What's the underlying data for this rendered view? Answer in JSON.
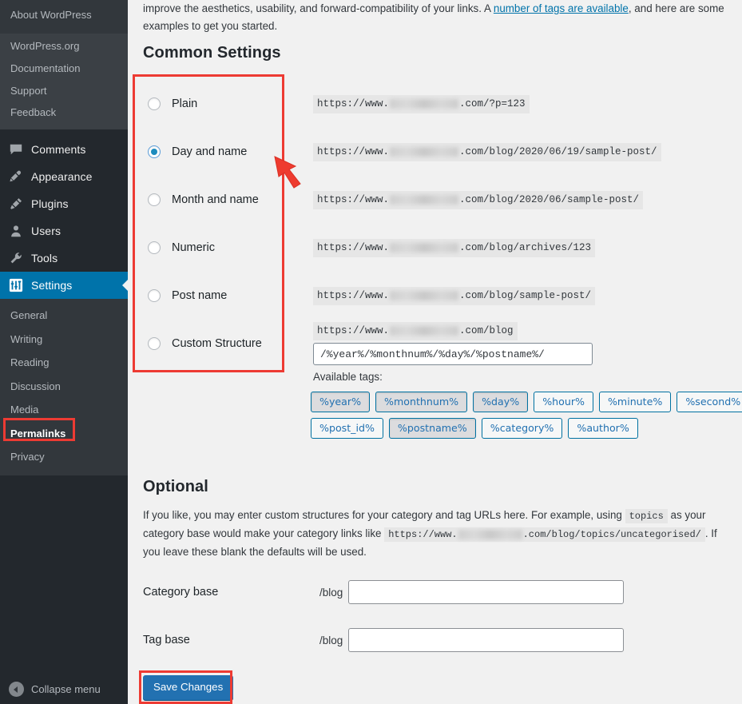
{
  "sidebar": {
    "flyout": {
      "title": "About WordPress",
      "items": [
        "WordPress.org",
        "Documentation",
        "Support",
        "Feedback"
      ]
    },
    "menu": [
      {
        "label": "Comments",
        "icon": "comment-icon",
        "current": false
      },
      {
        "label": "Appearance",
        "icon": "appearance-brush-icon",
        "current": false
      },
      {
        "label": "Plugins",
        "icon": "plugin-plug-icon",
        "current": false
      },
      {
        "label": "Users",
        "icon": "user-icon",
        "current": false
      },
      {
        "label": "Tools",
        "icon": "wrench-icon",
        "current": false
      },
      {
        "label": "Settings",
        "icon": "settings-sliders-icon",
        "current": true
      }
    ],
    "submenu": [
      {
        "label": "General",
        "active": false
      },
      {
        "label": "Writing",
        "active": false
      },
      {
        "label": "Reading",
        "active": false
      },
      {
        "label": "Discussion",
        "active": false
      },
      {
        "label": "Media",
        "active": false
      },
      {
        "label": "Permalinks",
        "active": true
      },
      {
        "label": "Privacy",
        "active": false
      }
    ],
    "collapse_label": "Collapse menu"
  },
  "intro": {
    "text_before_link": "improve the aesthetics, usability, and forward-compatibility of your links. A ",
    "link_text": "number of tags are available",
    "text_after_link": ", and here are some examples to get you started."
  },
  "common_settings": {
    "heading": "Common Settings",
    "options": [
      {
        "label": "Plain",
        "checked": false,
        "example_prefix": "https://www.",
        "example_suffix": ".com/?p=123"
      },
      {
        "label": "Day and name",
        "checked": true,
        "example_prefix": "https://www.",
        "example_suffix": ".com/blog/2020/06/19/sample-post/"
      },
      {
        "label": "Month and name",
        "checked": false,
        "example_prefix": "https://www.",
        "example_suffix": ".com/blog/2020/06/sample-post/"
      },
      {
        "label": "Numeric",
        "checked": false,
        "example_prefix": "https://www.",
        "example_suffix": ".com/blog/archives/123"
      },
      {
        "label": "Post name",
        "checked": false,
        "example_prefix": "https://www.",
        "example_suffix": ".com/blog/sample-post/"
      },
      {
        "label": "Custom Structure",
        "checked": false,
        "example_prefix": "https://www.",
        "example_suffix": ".com/blog"
      }
    ],
    "custom_structure_value": "/%year%/%monthnum%/%day%/%postname%/",
    "available_tags_label": "Available tags:",
    "tags": [
      {
        "label": "%year%",
        "used": true
      },
      {
        "label": "%monthnum%",
        "used": true
      },
      {
        "label": "%day%",
        "used": true
      },
      {
        "label": "%hour%",
        "used": false
      },
      {
        "label": "%minute%",
        "used": false
      },
      {
        "label": "%second%",
        "used": false
      },
      {
        "label": "%post_id%",
        "used": false
      },
      {
        "label": "%postname%",
        "used": true
      },
      {
        "label": "%category%",
        "used": false
      },
      {
        "label": "%author%",
        "used": false
      }
    ]
  },
  "optional": {
    "heading": "Optional",
    "part1": "If you like, you may enter custom structures for your category and tag URLs here. For example, using ",
    "code1": "topics",
    "part2": " as your category base would make your category links like ",
    "code2_prefix": "https://www.",
    "code2_suffix": ".com/blog/topics/uncategorised/",
    "part3": ". If you leave these blank the defaults will be used.",
    "category_base_label": "Category base",
    "category_base_prefix": "/blog",
    "category_base_value": "",
    "tag_base_label": "Tag base",
    "tag_base_prefix": "/blog",
    "tag_base_value": ""
  },
  "save_label": "Save Changes",
  "annotation_color": "#ed3b33",
  "accent_color": "#0073aa"
}
